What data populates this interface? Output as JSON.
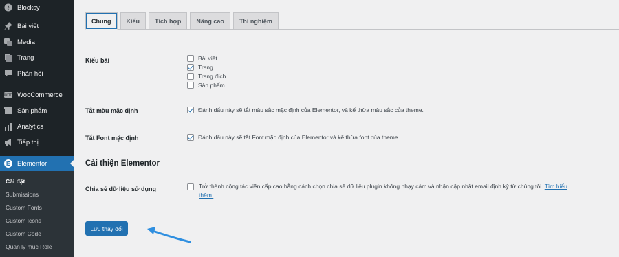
{
  "sidebar": {
    "items": [
      {
        "label": "Blocksy",
        "icon": "blocksy-icon"
      },
      {
        "label": "Bài viết",
        "icon": "pin-icon"
      },
      {
        "label": "Media",
        "icon": "media-icon"
      },
      {
        "label": "Trang",
        "icon": "page-icon"
      },
      {
        "label": "Phản hồi",
        "icon": "comment-icon"
      },
      {
        "label": "WooCommerce",
        "icon": "woocommerce-icon"
      },
      {
        "label": "Sản phẩm",
        "icon": "product-icon"
      },
      {
        "label": "Analytics",
        "icon": "analytics-icon"
      },
      {
        "label": "Tiếp thị",
        "icon": "megaphone-icon"
      },
      {
        "label": "Elementor",
        "icon": "elementor-icon"
      }
    ],
    "submenu": [
      "Cài đặt",
      "Submissions",
      "Custom Fonts",
      "Custom Icons",
      "Custom Code",
      "Quản lý mục Role"
    ]
  },
  "tabs": [
    "Chung",
    "Kiểu",
    "Tích hợp",
    "Nâng cao",
    "Thí nghiệm"
  ],
  "post_types": {
    "label": "Kiểu bài",
    "options": [
      {
        "label": "Bài viết",
        "checked": false
      },
      {
        "label": "Trang",
        "checked": true
      },
      {
        "label": "Trang đích",
        "checked": false
      },
      {
        "label": "Sản phẩm",
        "checked": false
      }
    ]
  },
  "disable_colors": {
    "label": "Tắt màu mặc định",
    "text": "Đánh dấu này sẽ tắt màu sắc mặc định của Elementor, và kế thừa màu sắc của theme.",
    "checked": true
  },
  "disable_fonts": {
    "label": "Tắt Font mặc định",
    "text": "Đánh dấu này sẽ tắt Font mặc định của Elementor và kế thừa font của theme.",
    "checked": true
  },
  "improve": {
    "title": "Cải thiện Elementor",
    "label": "Chia sẻ dữ liệu sử dụng",
    "text": "Trở thành cộng tác viên cấp cao bằng cách chọn chia sẻ dữ liệu plugin không nhạy cảm và nhận cập nhật email định kỳ từ chúng tôi.",
    "link_part1": "Tìm hiểu",
    "link_part2": "thêm.",
    "checked": false
  },
  "save_label": "Lưu thay đổi",
  "colors": {
    "accent": "#2271b1",
    "sidebar": "#1d2327",
    "annotation_arrow": "#2f8fe0"
  }
}
